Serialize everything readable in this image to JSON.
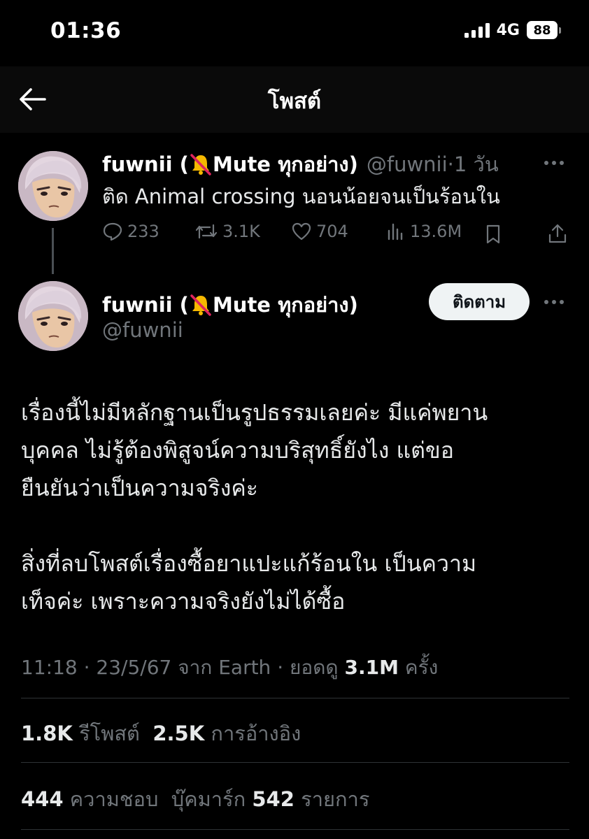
{
  "status_bar": {
    "time": "01:36",
    "network": "4G",
    "battery": "88"
  },
  "header": {
    "title": "โพสต์"
  },
  "parent_post": {
    "display_name": "fuwnii (",
    "name_suffix": "Mute ทุกอย่าง)",
    "handle": "@fuwnii",
    "age": "·1 วัน",
    "text": "ติด Animal crossing นอนน้อยจนเป็นร้อนใน",
    "replies": "233",
    "reposts": "3.1K",
    "likes": "704",
    "views": "13.6M"
  },
  "main_post": {
    "display_name": "fuwnii (",
    "name_suffix": "Mute ทุกอย่าง)",
    "handle": "@fuwnii",
    "follow_label": "ติดตาม",
    "paragraph1": [
      "เรื่องนี้ไม่มีหลักฐานเป็นรูปธรรมเลยค่ะ มีแค่พยาน",
      "บุคคล ไม่รู้ต้องพิสูจน์ความบริสุทธิ์ยังไง แต่ขอ",
      "ยืนยันว่าเป็นความจริงค่ะ"
    ],
    "paragraph2": [
      "สิ่งที่ลบโพสต์เรื่องซื้อยาแปะแก้ร้อนใน เป็นความ",
      "เท็จค่ะ เพราะความจริงยังไม่ได้ซื้อ"
    ],
    "meta_prefix": "11:18 · 23/5/67 จาก Earth · ยอดดู ",
    "meta_views": "3.1M",
    "meta_suffix": " ครั้ง",
    "reposts_count": "1.8K",
    "reposts_label": "รีโพสต์",
    "quotes_count": "2.5K",
    "quotes_label": "การอ้างอิง",
    "likes_count": "444",
    "likes_label": "ความชอบ",
    "bookmarks_label": "บุ๊คมาร์ก",
    "bookmarks_count": "542",
    "bookmarks_suffix": "รายการ"
  },
  "colors": {
    "background": "#000000",
    "text": "#e7e9ea",
    "muted": "#71767b",
    "divider": "#2f3336",
    "bell": "#f5b800",
    "strike": "#e0245e"
  }
}
